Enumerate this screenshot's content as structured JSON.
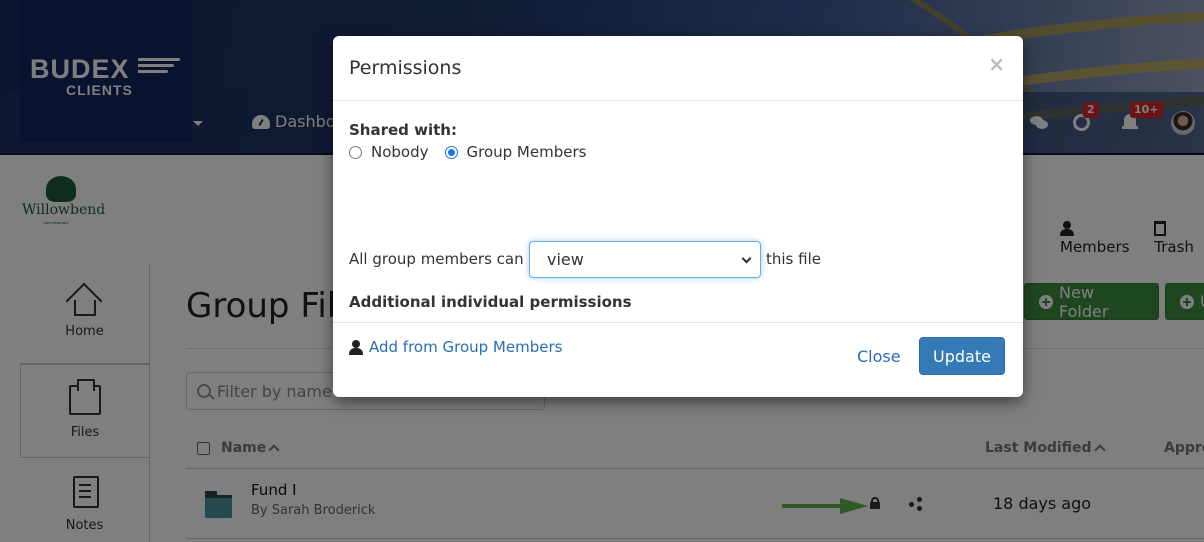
{
  "header": {
    "brand": "BUDEX",
    "brand_sub": "CLIENTS",
    "nav_dashboard": "Dashboard",
    "badges": {
      "messages": "2",
      "notifications": "10+"
    }
  },
  "company": {
    "name": "Willowbend",
    "sub": "Investments"
  },
  "sidebar": {
    "items": [
      {
        "label": "Home",
        "icon": "home-icon"
      },
      {
        "label": "Files",
        "icon": "folder-icon",
        "active": true
      },
      {
        "label": "Notes",
        "icon": "notes-icon"
      }
    ]
  },
  "page": {
    "title": "Group Files",
    "actions": {
      "members": "Members",
      "trash": "Trash"
    },
    "buttons": {
      "new_folder": "New Folder",
      "upload": "Upload"
    },
    "filter_placeholder": "Filter by name"
  },
  "table": {
    "columns": [
      "Name",
      "Last Modified",
      "Approval"
    ],
    "rows": [
      {
        "name": "Fund I",
        "by": "By  Sarah Broderick",
        "modified": "18 days ago"
      }
    ]
  },
  "modal": {
    "title": "Permissions",
    "close_x": "×",
    "shared_with_label": "Shared with:",
    "options": [
      {
        "label": "Nobody",
        "checked": false
      },
      {
        "label": "Group Members",
        "checked": true
      }
    ],
    "perm_prefix": "All group members can",
    "perm_value": "view",
    "perm_suffix": "this file",
    "additional_label": "Additional individual permissions",
    "add_link": "Add from Group Members",
    "close_button": "Close",
    "update_button": "Update"
  },
  "colors": {
    "primary": "#337ab7",
    "link": "#2a6db5",
    "success": "#3f8f3f",
    "badge": "#d9262a",
    "annotation_arrow": "#5fb34a"
  }
}
